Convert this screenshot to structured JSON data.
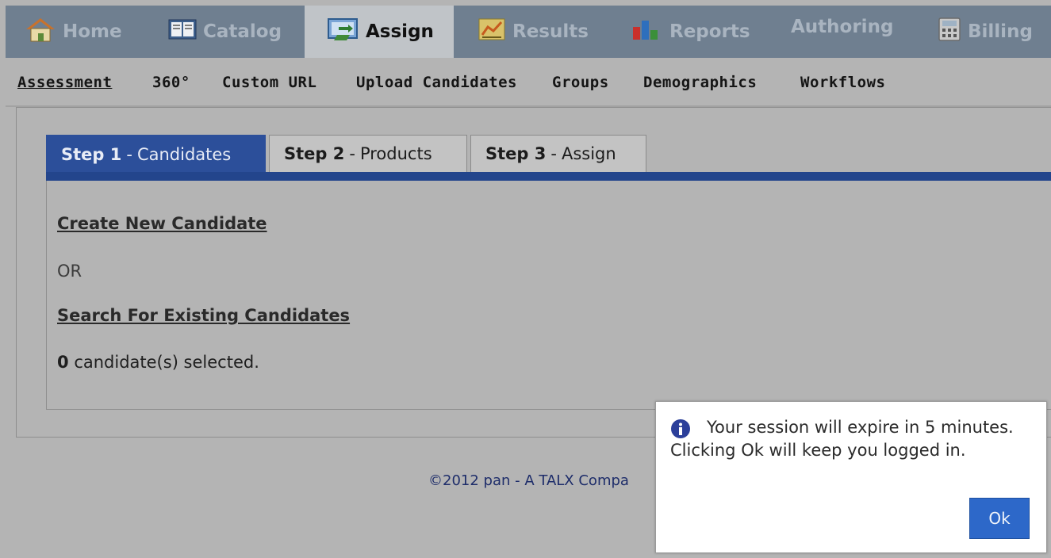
{
  "nav": {
    "tabs": [
      {
        "label": "Home",
        "icon": "home-icon"
      },
      {
        "label": "Catalog",
        "icon": "book-icon"
      },
      {
        "label": "Assign",
        "icon": "assign-screen-icon"
      },
      {
        "label": "Results",
        "icon": "results-chart-icon"
      },
      {
        "label": "Reports",
        "icon": "bar-chart-icon"
      },
      {
        "label": "Authoring",
        "icon": ""
      },
      {
        "label": "Billing",
        "icon": "calculator-icon"
      }
    ],
    "active": "Assign"
  },
  "subnav": {
    "items": [
      "Assessment",
      "360°",
      "Custom URL",
      "Upload Candidates",
      "Groups",
      "Demographics",
      "Workflows"
    ],
    "current": "Assessment"
  },
  "steps": [
    {
      "num": "Step 1",
      "sep": "-",
      "name": "Candidates"
    },
    {
      "num": "Step 2",
      "sep": "-",
      "name": "Products"
    },
    {
      "num": "Step 3",
      "sep": "-",
      "name": "Assign"
    }
  ],
  "content": {
    "create_link": "Create New Candidate",
    "or_text": "OR",
    "search_link": "Search For Existing Candidates",
    "selected_count": "0",
    "selected_suffix": "candidate(s) selected."
  },
  "footer": {
    "text": "©2012 pan - A TALX Compa"
  },
  "dialog": {
    "message": "Your session will expire in 5 minutes. Clicking Ok will keep you logged in.",
    "ok_label": "Ok"
  },
  "colors": {
    "nav_bg": "#6f7f90",
    "active_step": "#2c4f9a",
    "ok_button": "#2d68c9",
    "info_icon": "#2b3f9a"
  }
}
